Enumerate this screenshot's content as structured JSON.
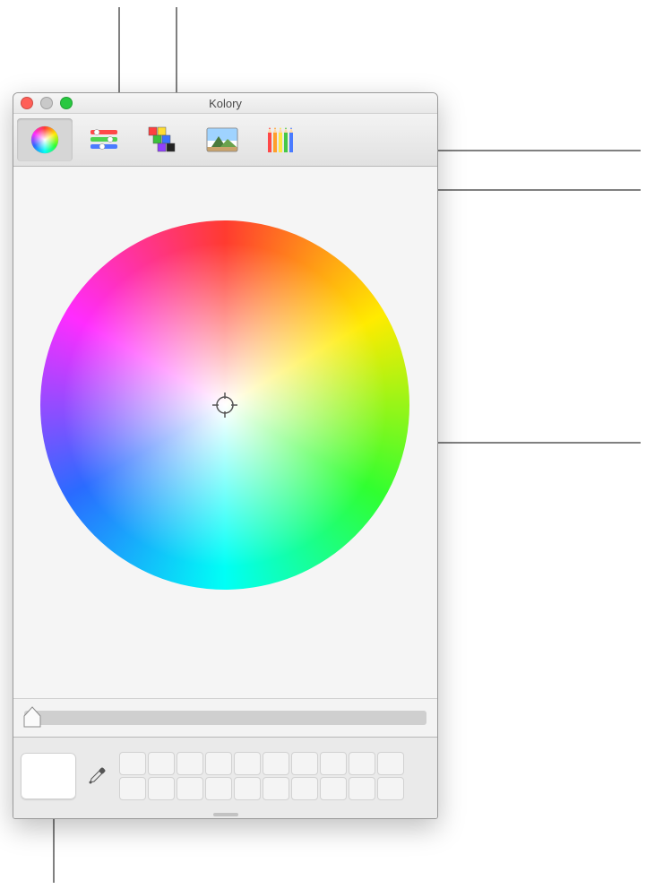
{
  "window": {
    "title": "Kolory"
  },
  "toolbar": {
    "tabs": [
      {
        "name": "color-wheel",
        "selected": true
      },
      {
        "name": "color-sliders",
        "selected": false
      },
      {
        "name": "color-palettes",
        "selected": false
      },
      {
        "name": "image-palettes",
        "selected": false
      },
      {
        "name": "pencils",
        "selected": false
      }
    ]
  },
  "brightness_slider": {
    "value_percent": 0
  },
  "current_color": "#ffffff",
  "swatch_rows": 2,
  "swatch_cols": 10
}
